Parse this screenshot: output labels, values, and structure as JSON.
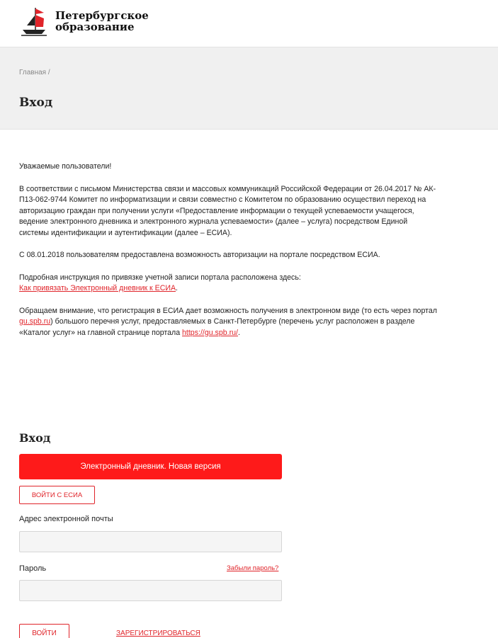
{
  "colors": {
    "accent": "#fe1a1a",
    "link": "#e0242a",
    "banner_bg": "#f0f0f0"
  },
  "header": {
    "logo_icon": "ship-icon",
    "logo_line1": "Петербургское",
    "logo_line2": "образование"
  },
  "banner": {
    "breadcrumb": "Главная /",
    "title": "Вход"
  },
  "content": {
    "greeting": "Уважаемые пользователи!",
    "para1": "В соответствии с письмом Министерства связи и массовых коммуникаций Российской Федерации от 26.04.2017 № АК-П13-062-9744 Комитет по информатизации и связи совместно с Комитетом по образованию осуществил переход на авторизацию граждан при получении услуги «Предоставление информации о текущей успеваемости учащегося, ведение электронного дневника и электронного журнала успеваемости» (далее – услуга) посредством Единой системы идентификации и аутентификации (далее – ЕСИА).",
    "para2": "С 08.01.2018 пользователям предоставлена возможность авторизации на портале посредством ЕСИА.",
    "para3_text": "Подробная инструкция по привязке учетной записи портала расположена здесь:",
    "para3_link": "Как привязать Электронный дневник к ЕСИА",
    "para3_end": ".",
    "para4_a": "Обращаем внимание, что регистрация в ЕСИА дает возможность получения в электронном виде (то есть через портал ",
    "para4_link1": "gu.spb.ru",
    "para4_b": ") большого перечня услуг, предоставляемых в Санкт-Петербурге (перечень услуг расположен в разделе «Каталог услуг» на главной странице портала ",
    "para4_link2": "https://gu.spb.ru/",
    "para4_end": "."
  },
  "login": {
    "title": "Вход",
    "diary_button": "Электронный дневник. Новая версия",
    "esia_button": "ВОЙТИ С ЕСИА",
    "email_label": "Адрес электронной почты",
    "email_value": "",
    "email_placeholder": "",
    "password_label": "Пароль",
    "password_value": "",
    "forgot_link": "Забыли пароль?",
    "login_button": "ВОЙТИ",
    "register_link": "ЗАРЕГИСТРИРОВАТЬСЯ"
  }
}
